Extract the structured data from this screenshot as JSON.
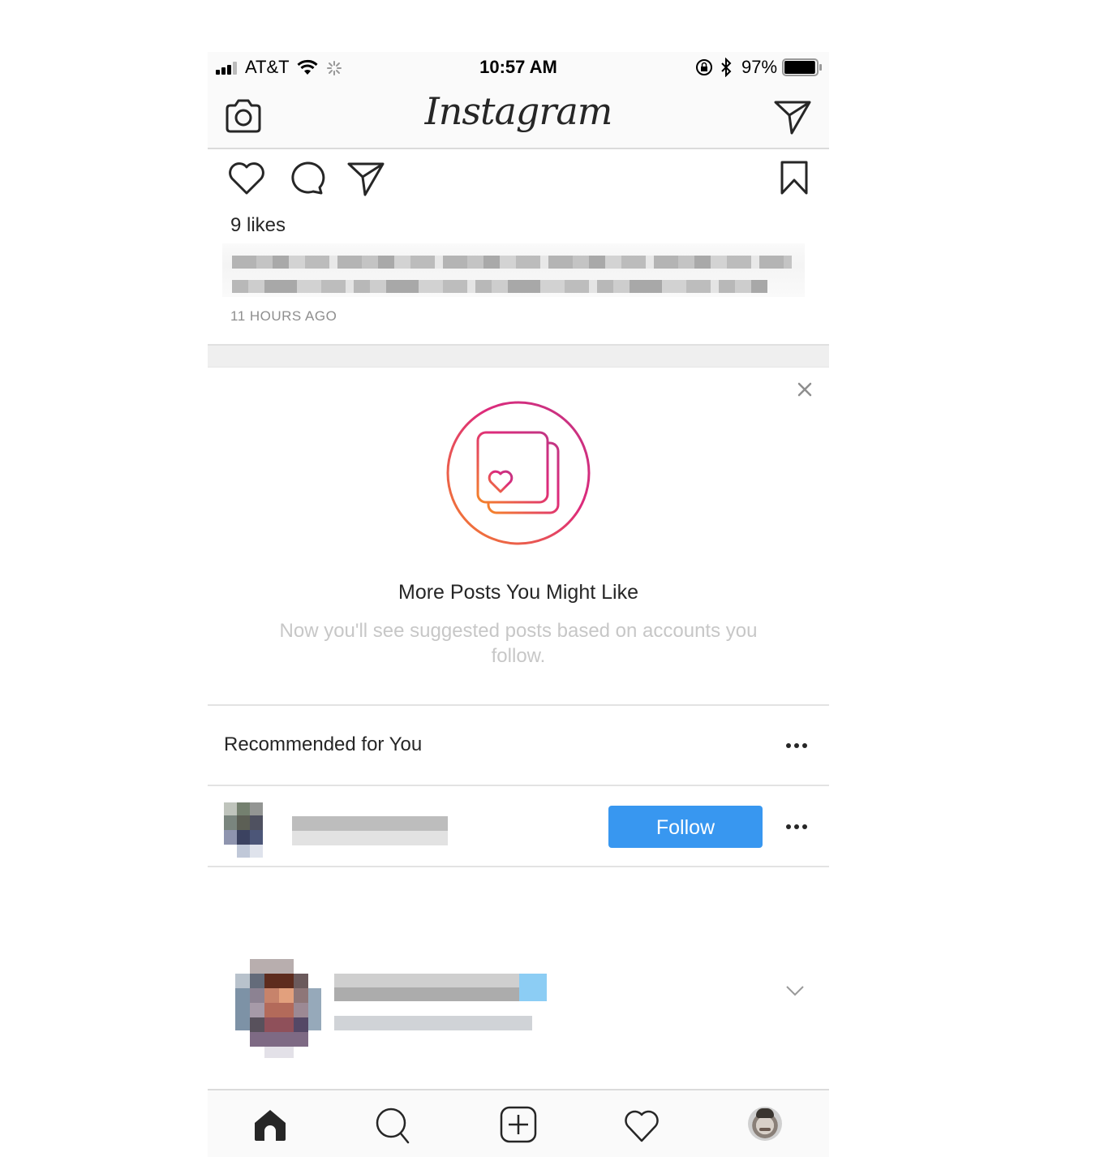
{
  "status_bar": {
    "carrier": "AT&T",
    "time": "10:57 AM",
    "battery_percent": "97%",
    "battery_level": 0.97
  },
  "nav": {
    "title": "Instagram",
    "left_icon": "camera-icon",
    "right_icon": "direct-message-icon"
  },
  "post": {
    "actions": [
      "like-icon",
      "comment-icon",
      "share-icon",
      "bookmark-icon"
    ],
    "likes": "9 likes",
    "time_ago": "11 HOURS AGO"
  },
  "suggested_posts_card": {
    "title": "More Posts You Might Like",
    "subtitle": "Now you'll see suggested posts based on accounts you follow.",
    "gradient_colors": [
      "#f58529",
      "#dd2a7b",
      "#c13584"
    ]
  },
  "recommended": {
    "title": "Recommended for You",
    "follow_label": "Follow",
    "follow_color": "#3897f0"
  },
  "tab_bar": {
    "tabs": [
      "home-icon",
      "search-icon",
      "new-post-icon",
      "activity-icon",
      "profile-avatar"
    ],
    "active_tab": "home-icon"
  }
}
